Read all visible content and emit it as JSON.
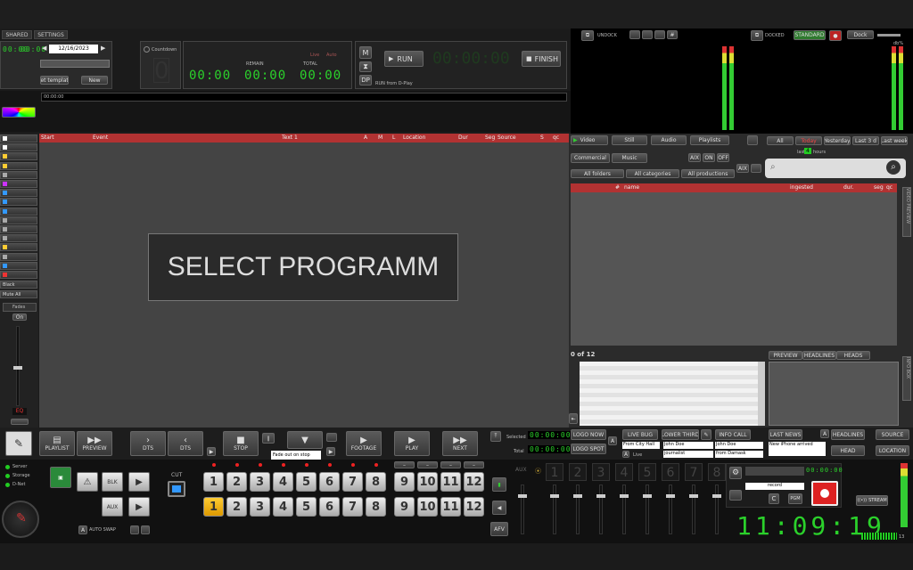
{
  "top": {
    "tabs": [
      "SHARED",
      "SETTINGS"
    ],
    "date": "12/16/2023",
    "set_template": "Set template",
    "new": "New",
    "countdown": "Countdown",
    "remain": "REMAIN",
    "total": "TOTAL",
    "live": "Live",
    "auto": "Auto",
    "time_zero": "00:00",
    "m": "M",
    "dp": "DP",
    "run": "RUN",
    "run_from_dplay": "RUN from D-Play",
    "finish": "FINISH",
    "undock": "UNDOCK",
    "docked": "DOCKED",
    "standard": "STANDARD",
    "dock": "Dock",
    "db": "db%",
    "timeline_time": "00:00:00"
  },
  "playlist": {
    "columns": [
      "Start",
      "Event",
      "Text 1",
      "A",
      "M",
      "L",
      "Location",
      "Dur",
      "Seg",
      "Source",
      "S",
      "qc"
    ],
    "select_message": "SELECT PROGRAMM"
  },
  "sidebar": {
    "black": "Black",
    "mute_all": "Mute All",
    "fade_in": "Fades",
    "on": "On",
    "level": "EQ"
  },
  "media": {
    "video": "Video",
    "still": "Still",
    "audio": "Audio",
    "playlists": "Playlists",
    "all": "All",
    "today": "Today",
    "yesterday": "Yesterday",
    "last3": "Last 3 d",
    "last_week": "Last week",
    "last_hours": "last",
    "hours_value": "4",
    "hours": "hours",
    "commercial": "Commercial",
    "music": "Music",
    "aix": "AIX",
    "on": "ON",
    "off": "OFF",
    "all_folders": "All folders",
    "all_categories": "All categories",
    "all_productions": "All productions",
    "col_name": "name",
    "col_ingested": "ingested",
    "col_dur": "dur.",
    "col_seg": "seg",
    "col_qc": "qc",
    "count": "0 of 12",
    "preview_tab": "PREVIEW",
    "headlines_tab": "HEADLINES",
    "heads_tab": "HEADS",
    "right_tab_1": "VIDEO PREVIEW",
    "right_tab_2": "INFO BOX"
  },
  "transport": {
    "playlist": "PLAYLIST",
    "preview": "PREVIEW",
    "dts1": "DTS",
    "dts2": "DTS",
    "stop": "STOP",
    "fade_tooltip": "Fade out on stop",
    "footage": "FOOTAGE",
    "play": "PLAY",
    "next": "NEXT",
    "selected": "Selected",
    "total": "Total",
    "time_zero": "00:00:00",
    "num_s": "S",
    "num_l": "L"
  },
  "logo": {
    "logo_now": "LOGO NOW",
    "logo_spot": "LOGO SPOT",
    "a": "A",
    "live_bug": "LIVE BUG",
    "lower_third": "LOWER THIRD",
    "info_call": "INFO CALL",
    "last_news": "LAST NEWS",
    "headlines": "HEADLINES",
    "source": "SOURCE",
    "head": "HEAD",
    "location": "LOCATION",
    "from_city_hall": "From City Hall",
    "live": "Live",
    "john_doe": "John Doe",
    "journalist": "journalist",
    "from_damask": "from Damask",
    "new_iphone": "New iPhone arrived"
  },
  "bottom": {
    "server": "Server",
    "storage": "Storage",
    "dnet": "D-Net",
    "blk": "BLK",
    "aux": "AUX",
    "cut": "CUT",
    "auto_swap": "AUTO SWAP",
    "numbers": [
      "1",
      "2",
      "3",
      "4",
      "5",
      "6",
      "7",
      "8",
      "9",
      "10",
      "11",
      "12"
    ],
    "mixer_numbers": [
      "1",
      "2",
      "3",
      "4",
      "5",
      "6",
      "7",
      "8"
    ],
    "aux_label": "AUX",
    "afv": "AFV",
    "record": "record",
    "c": "C",
    "pgm": "PGM",
    "stream": "STREAM",
    "clock": "11:09:19",
    "clock_frames": "13"
  }
}
